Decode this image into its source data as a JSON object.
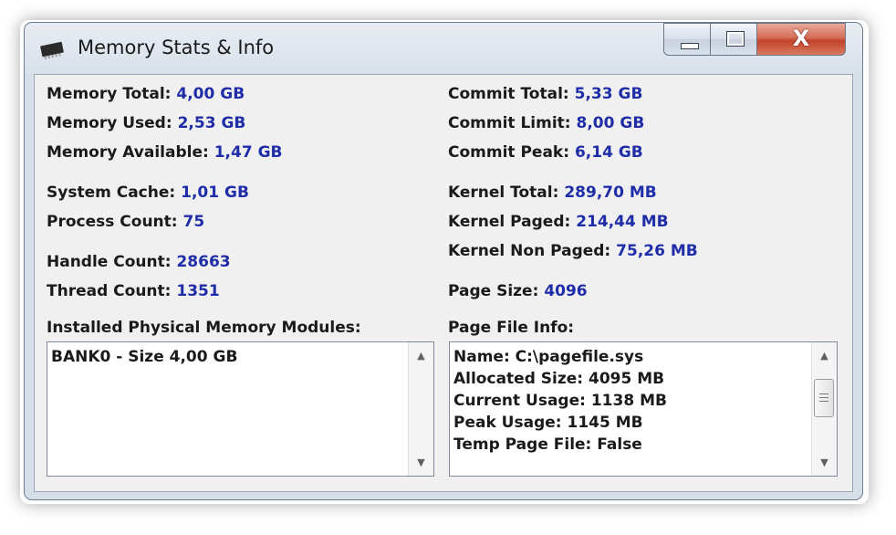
{
  "window": {
    "title": "Memory Stats & Info",
    "app_icon": "memory-chip-icon",
    "controls": {
      "minimize": "minimize-icon",
      "maximize": "maximize-icon",
      "close": "close-icon"
    },
    "close_glyph": "X"
  },
  "left": {
    "memory_total": {
      "label": "Memory Total:",
      "value": "4,00 GB"
    },
    "memory_used": {
      "label": "Memory Used:",
      "value": "2,53 GB"
    },
    "memory_available": {
      "label": "Memory Available:",
      "value": "1,47 GB"
    },
    "system_cache": {
      "label": "System Cache:",
      "value": "1,01 GB"
    },
    "process_count": {
      "label": "Process Count:",
      "value": "75"
    },
    "handle_count": {
      "label": "Handle Count:",
      "value": "28663"
    },
    "thread_count": {
      "label": "Thread Count:",
      "value": "1351"
    },
    "modules_header": "Installed Physical Memory Modules:",
    "modules": [
      "BANK0 - Size 4,00 GB"
    ]
  },
  "right": {
    "commit_total": {
      "label": "Commit Total:",
      "value": "5,33 GB"
    },
    "commit_limit": {
      "label": "Commit Limit:",
      "value": "8,00 GB"
    },
    "commit_peak": {
      "label": "Commit Peak:",
      "value": "6,14 GB"
    },
    "kernel_total": {
      "label": "Kernel Total:",
      "value": "289,70 MB"
    },
    "kernel_paged": {
      "label": "Kernel Paged:",
      "value": "214,44 MB"
    },
    "kernel_non_paged": {
      "label": "Kernel Non Paged:",
      "value": "75,26 MB"
    },
    "page_size": {
      "label": "Page Size:",
      "value": "4096"
    },
    "pagefile_header": "Page File Info:",
    "pagefile_lines": [
      "Name: C:\\pagefile.sys",
      "Allocated Size: 4095 MB",
      "Current Usage: 1138 MB",
      "Peak Usage: 1145 MB",
      "Temp Page File: False"
    ]
  },
  "colors": {
    "value_text": "#1f2ea8",
    "label_text": "#1a1a1a",
    "close_button": "#c3432a"
  }
}
